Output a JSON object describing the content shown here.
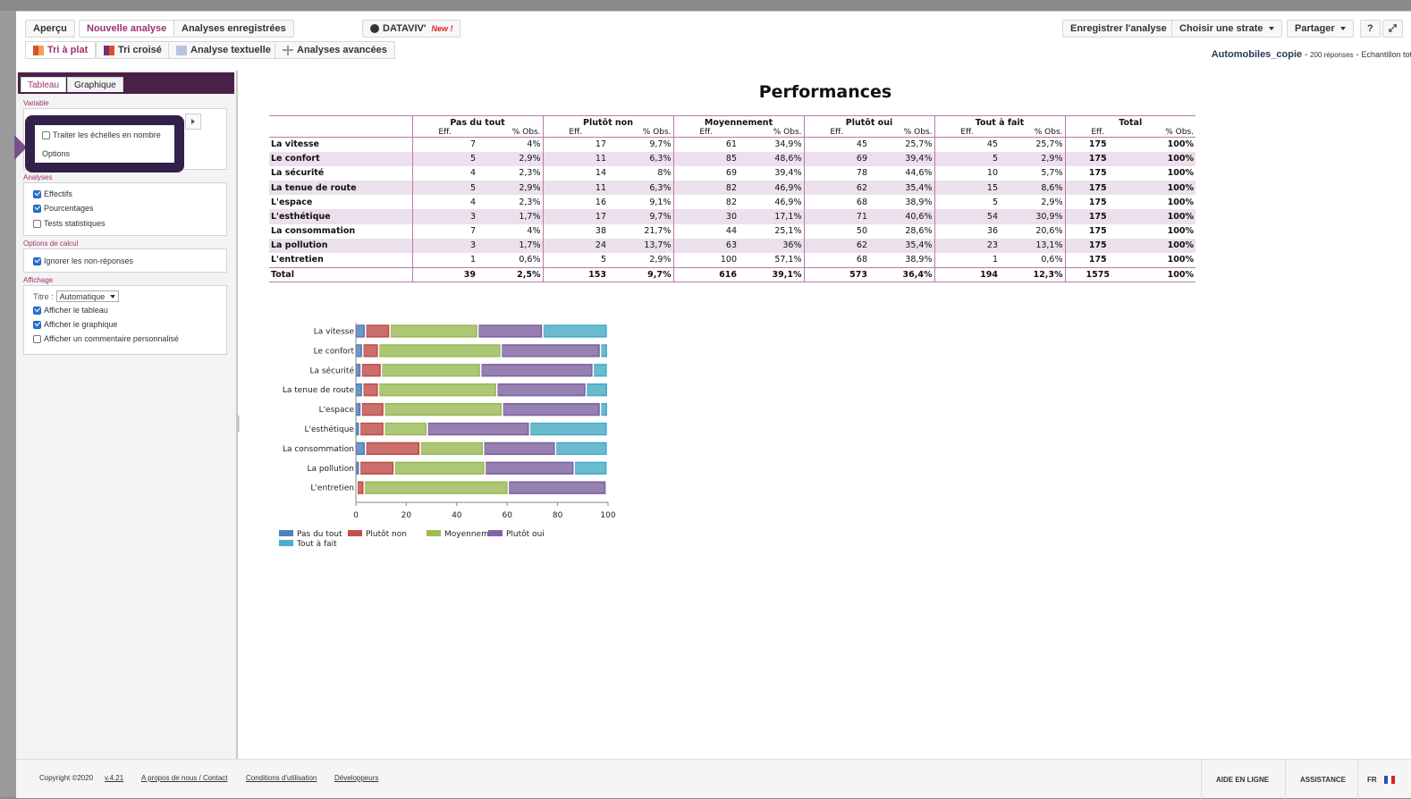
{
  "toolbar": {
    "apercu": "Aperçu",
    "nouvelle_analyse": "Nouvelle analyse",
    "analyses_enregistrees": "Analyses enregistrées",
    "dataviv": "DATAVIV'",
    "dataviv_new": "New !",
    "enregistrer": "Enregistrer l'analyse",
    "choisir_strate": "Choisir une strate",
    "partager": "Partager",
    "help": "?",
    "expand": "⤢"
  },
  "subtoolbar": {
    "tri_a_plat": "Tri à plat",
    "tri_croise": "Tri croisé",
    "analyse_textuelle": "Analyse textuelle",
    "analyses_avancees": "Analyses avancées"
  },
  "dataset": {
    "name": "Automobiles_copie",
    "sep1": "-",
    "responses": "200 réponses",
    "sep2": "-",
    "sample": "Echantillon total"
  },
  "left_panel": {
    "tab_tableau": "Tableau",
    "tab_graphique": "Graphique",
    "variable_label": "Variable",
    "popup_checkbox": "Traiter les échelles en nombre",
    "popup_options": "Options",
    "analyses_label": "Analyses",
    "effectifs": "Effectifs",
    "pourcentages": "Pourcentages",
    "tests": "Tests statistiques",
    "options_calcul_label": "Options de calcul",
    "ignorer": "Ignorer les non-réponses",
    "affichage_label": "Affichage",
    "titre_label": "Titre :",
    "titre_value": "Automatique",
    "afficher_tableau": "Afficher le tableau",
    "afficher_graphique": "Afficher le graphique",
    "afficher_commentaire": "Afficher un commentaire personnalisé"
  },
  "content": {
    "title": "Performances",
    "groups": [
      "Pas du tout",
      "Plutôt non",
      "Moyennement",
      "Plutôt oui",
      "Tout à fait",
      "Total"
    ],
    "subheaders": [
      "Eff.",
      "% Obs."
    ],
    "rows": [
      {
        "label": "La vitesse",
        "cells": [
          "7",
          "4%",
          "17",
          "9,7%",
          "61",
          "34,9%",
          "45",
          "25,7%",
          "45",
          "25,7%",
          "175",
          "100%"
        ]
      },
      {
        "label": "Le confort",
        "cells": [
          "5",
          "2,9%",
          "11",
          "6,3%",
          "85",
          "48,6%",
          "69",
          "39,4%",
          "5",
          "2,9%",
          "175",
          "100%"
        ]
      },
      {
        "label": "La sécurité",
        "cells": [
          "4",
          "2,3%",
          "14",
          "8%",
          "69",
          "39,4%",
          "78",
          "44,6%",
          "10",
          "5,7%",
          "175",
          "100%"
        ]
      },
      {
        "label": "La tenue de route",
        "cells": [
          "5",
          "2,9%",
          "11",
          "6,3%",
          "82",
          "46,9%",
          "62",
          "35,4%",
          "15",
          "8,6%",
          "175",
          "100%"
        ]
      },
      {
        "label": "L'espace",
        "cells": [
          "4",
          "2,3%",
          "16",
          "9,1%",
          "82",
          "46,9%",
          "68",
          "38,9%",
          "5",
          "2,9%",
          "175",
          "100%"
        ]
      },
      {
        "label": "L'esthétique",
        "cells": [
          "3",
          "1,7%",
          "17",
          "9,7%",
          "30",
          "17,1%",
          "71",
          "40,6%",
          "54",
          "30,9%",
          "175",
          "100%"
        ]
      },
      {
        "label": "La consommation",
        "cells": [
          "7",
          "4%",
          "38",
          "21,7%",
          "44",
          "25,1%",
          "50",
          "28,6%",
          "36",
          "20,6%",
          "175",
          "100%"
        ]
      },
      {
        "label": "La pollution",
        "cells": [
          "3",
          "1,7%",
          "24",
          "13,7%",
          "63",
          "36%",
          "62",
          "35,4%",
          "23",
          "13,1%",
          "175",
          "100%"
        ]
      },
      {
        "label": "L'entretien",
        "cells": [
          "1",
          "0,6%",
          "5",
          "2,9%",
          "100",
          "57,1%",
          "68",
          "38,9%",
          "1",
          "0,6%",
          "175",
          "100%"
        ]
      }
    ],
    "total": {
      "label": "Total",
      "cells": [
        "39",
        "2,5%",
        "153",
        "9,7%",
        "616",
        "39,1%",
        "573",
        "36,4%",
        "194",
        "12,3%",
        "1575",
        "100%"
      ]
    }
  },
  "chart_data": {
    "type": "bar",
    "orientation": "horizontal",
    "stacked": true,
    "categories": [
      "La vitesse",
      "Le confort",
      "La sécurité",
      "La tenue de route",
      "L'espace",
      "L'esthétique",
      "La consommation",
      "La pollution",
      "L'entretien"
    ],
    "series": [
      {
        "name": "Pas du tout",
        "color": "#4f81bd",
        "values": [
          4,
          2.9,
          2.3,
          2.9,
          2.3,
          1.7,
          4,
          1.7,
          0.6
        ]
      },
      {
        "name": "Plutôt non",
        "color": "#c0504d",
        "values": [
          9.7,
          6.3,
          8,
          6.3,
          9.1,
          9.7,
          21.7,
          13.7,
          2.9
        ]
      },
      {
        "name": "Moyennement",
        "color": "#9bbb59",
        "values": [
          34.9,
          48.6,
          39.4,
          46.9,
          46.9,
          17.1,
          25.1,
          36,
          57.1
        ]
      },
      {
        "name": "Plutôt oui",
        "color": "#8064a2",
        "values": [
          25.7,
          39.4,
          44.6,
          35.4,
          38.9,
          40.6,
          28.6,
          35.4,
          38.9
        ]
      },
      {
        "name": "Tout à fait",
        "color": "#4bacc6",
        "values": [
          25.7,
          2.9,
          5.7,
          8.6,
          2.9,
          30.9,
          20.6,
          13.1,
          0.6
        ]
      }
    ],
    "xlim": [
      0,
      100
    ],
    "xticks": [
      "0",
      "20",
      "40",
      "60",
      "80",
      "100"
    ],
    "legend_position": "bottom"
  },
  "footer": {
    "copyright": "Copyright ©2020",
    "version": "v.4.21",
    "about": "A propos de nous / Contact",
    "conditions": "Conditions d'utilisation",
    "developers": "Développeurs",
    "aide": "AIDE EN LIGNE",
    "assistance": "ASSISTANCE",
    "lang": "FR"
  },
  "colors": {
    "accent": "#a0306f",
    "panel_dark": "#4a2048",
    "highlight_border": "#32214a"
  }
}
